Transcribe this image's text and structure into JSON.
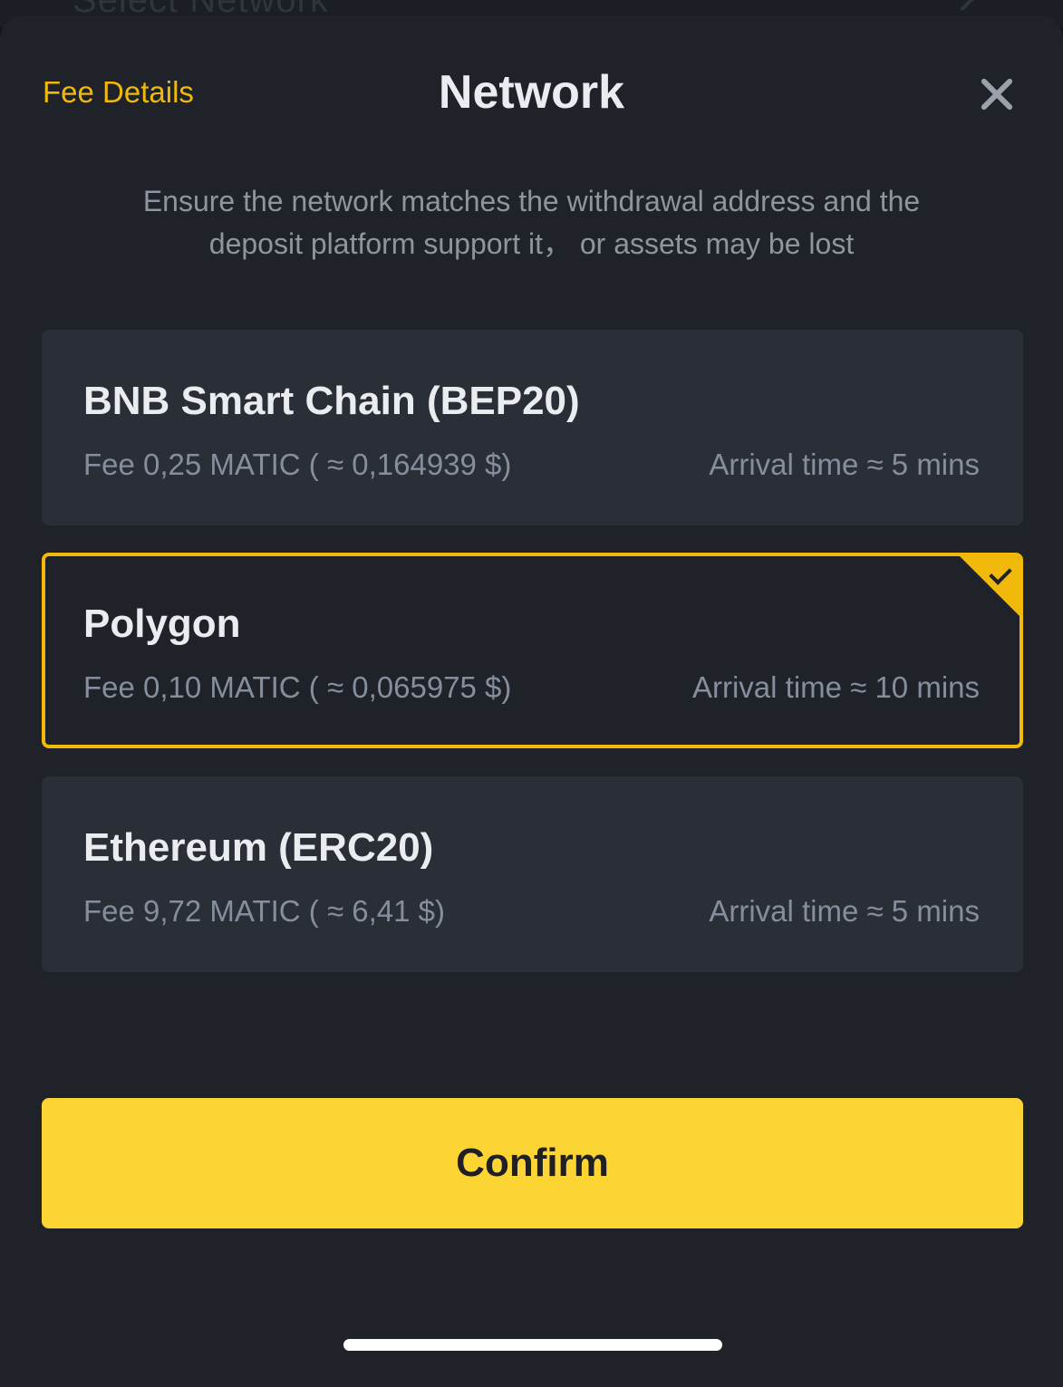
{
  "background_label": "Select Network",
  "header": {
    "fee_details": "Fee Details",
    "title": "Network"
  },
  "warning": {
    "line1": "Ensure the network matches the withdrawal address and the",
    "line2": "deposit platform support it， or assets may be lost"
  },
  "networks": [
    {
      "name": "BNB Smart Chain (BEP20)",
      "fee": "Fee 0,25 MATIC ( ≈ 0,164939 $)",
      "arrival": "Arrival time ≈ 5 mins",
      "selected": false
    },
    {
      "name": "Polygon",
      "fee": "Fee 0,10 MATIC ( ≈ 0,065975 $)",
      "arrival": "Arrival time ≈ 10 mins",
      "selected": true
    },
    {
      "name": "Ethereum (ERC20)",
      "fee": "Fee 9,72 MATIC ( ≈ 6,41 $)",
      "arrival": "Arrival time ≈ 5 mins",
      "selected": false
    }
  ],
  "confirm_label": "Confirm",
  "colors": {
    "accent": "#f0b90b",
    "button": "#fcd535",
    "card": "#2a2e36",
    "sheet": "#1f2229"
  }
}
